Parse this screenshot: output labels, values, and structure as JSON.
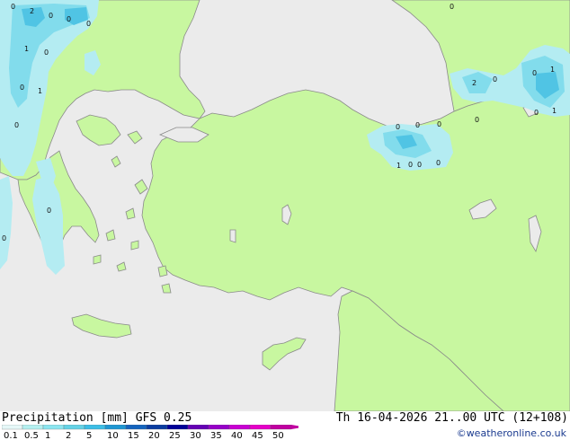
{
  "title": {
    "product": "Precipitation [mm]",
    "model": "GFS 0.25",
    "valid": "Th 16-04-2026 21..00 UTC (12+108)"
  },
  "credit": "©weatheronline.co.uk",
  "legend": {
    "labels": [
      "0.1",
      "0.5",
      "1",
      "2",
      "5",
      "10",
      "15",
      "20",
      "25",
      "30",
      "35",
      "40",
      "45",
      "50"
    ],
    "colors": [
      "#e6f8f8",
      "#b4f0f0",
      "#8ce6f0",
      "#64d2e6",
      "#3cbee6",
      "#1e96d2",
      "#1464be",
      "#0a3ca0",
      "#000096",
      "#6400b4",
      "#9600c8",
      "#c800d2",
      "#e600c8",
      "#c000a0"
    ]
  },
  "colors": {
    "land": "#c8f7a0",
    "sea": "#ebebeb",
    "coast": "#8a8a8a",
    "precip_light": "#b4ecf2",
    "precip_mid": "#82dcec",
    "precip_heavy": "#50c4e4"
  },
  "map_labels": [
    "0",
    "2",
    "0",
    "0",
    "0",
    "1",
    "0",
    "0",
    "1",
    "0",
    "0",
    "0",
    "0",
    "0",
    "0",
    "0",
    "2",
    "0",
    "0",
    "1",
    "1",
    "0",
    "0",
    "0",
    "0",
    "0",
    "1",
    "1",
    "0",
    "1",
    "0"
  ]
}
